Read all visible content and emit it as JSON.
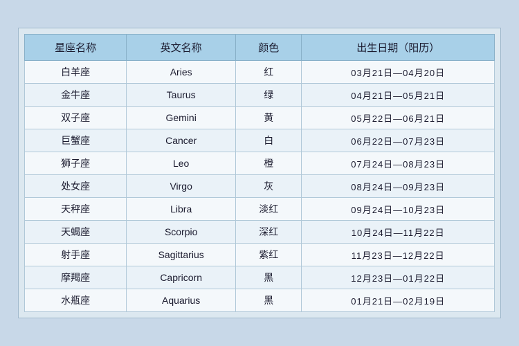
{
  "table": {
    "headers": [
      "星座名称",
      "英文名称",
      "颜色",
      "出生日期（阳历）"
    ],
    "rows": [
      {
        "chinese": "白羊座",
        "english": "Aries",
        "color": "红",
        "dates": "03月21日—04月20日"
      },
      {
        "chinese": "金牛座",
        "english": "Taurus",
        "color": "绿",
        "dates": "04月21日—05月21日"
      },
      {
        "chinese": "双子座",
        "english": "Gemini",
        "color": "黄",
        "dates": "05月22日—06月21日"
      },
      {
        "chinese": "巨蟹座",
        "english": "Cancer",
        "color": "白",
        "dates": "06月22日—07月23日"
      },
      {
        "chinese": "狮子座",
        "english": "Leo",
        "color": "橙",
        "dates": "07月24日—08月23日"
      },
      {
        "chinese": "处女座",
        "english": "Virgo",
        "color": "灰",
        "dates": "08月24日—09月23日"
      },
      {
        "chinese": "天秤座",
        "english": "Libra",
        "color": "淡红",
        "dates": "09月24日—10月23日"
      },
      {
        "chinese": "天蝎座",
        "english": "Scorpio",
        "color": "深红",
        "dates": "10月24日—11月22日"
      },
      {
        "chinese": "射手座",
        "english": "Sagittarius",
        "color": "紫红",
        "dates": "11月23日—12月22日"
      },
      {
        "chinese": "摩羯座",
        "english": "Capricorn",
        "color": "黑",
        "dates": "12月23日—01月22日"
      },
      {
        "chinese": "水瓶座",
        "english": "Aquarius",
        "color": "黑",
        "dates": "01月21日—02月19日"
      }
    ]
  }
}
